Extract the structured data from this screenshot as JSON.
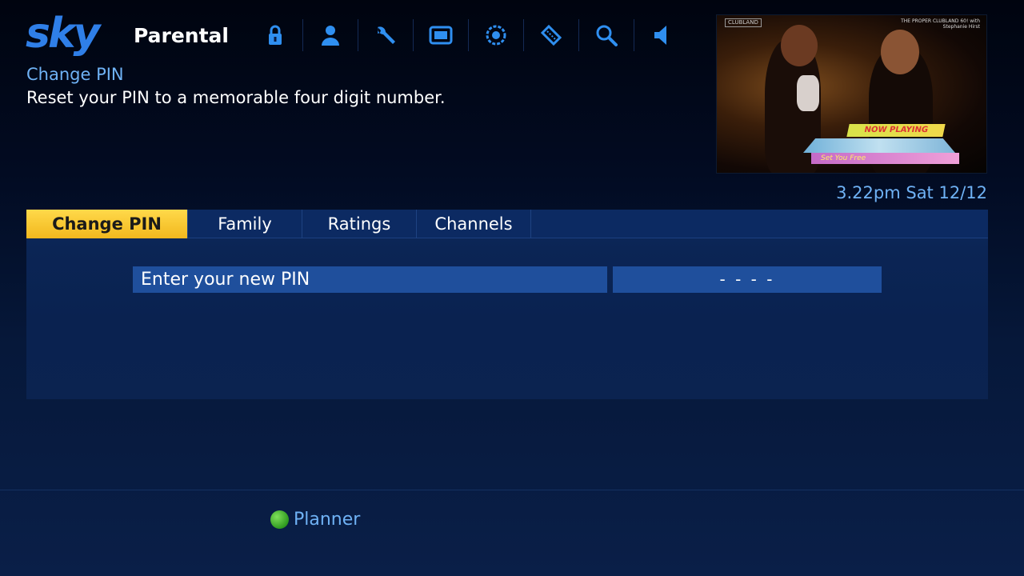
{
  "header": {
    "logo": "sky",
    "section": "Parental",
    "icons": [
      {
        "name": "lock-icon"
      },
      {
        "name": "person-icon"
      },
      {
        "name": "wrench-icon"
      },
      {
        "name": "tv-screen-icon"
      },
      {
        "name": "record-dial-icon"
      },
      {
        "name": "ticket-icon"
      },
      {
        "name": "search-icon"
      },
      {
        "name": "speaker-icon"
      }
    ]
  },
  "info": {
    "title": "Change PIN",
    "description": "Reset your PIN to a memorable four digit number."
  },
  "preview": {
    "channel_logo": "CLUBLAND",
    "show_caption": "THE PROPER CLUBLAND 60! with Stephanie Hirst",
    "now_playing_label": "NOW PLAYING",
    "song": "Set You Free"
  },
  "datetime": "3.22pm Sat 12/12",
  "tabs": [
    {
      "label": "Change PIN",
      "active": true
    },
    {
      "label": "Family",
      "active": false
    },
    {
      "label": "Ratings",
      "active": false
    },
    {
      "label": "Channels",
      "active": false
    }
  ],
  "pin_form": {
    "label": "Enter your new PIN",
    "value": "- - - -"
  },
  "footer": {
    "planner_label": "Planner",
    "planner_color": "#3fbf2a"
  },
  "colors": {
    "accent_blue": "#6fb2f5",
    "active_tab": "#f2b81e",
    "row_bg": "#1f4f9c"
  }
}
